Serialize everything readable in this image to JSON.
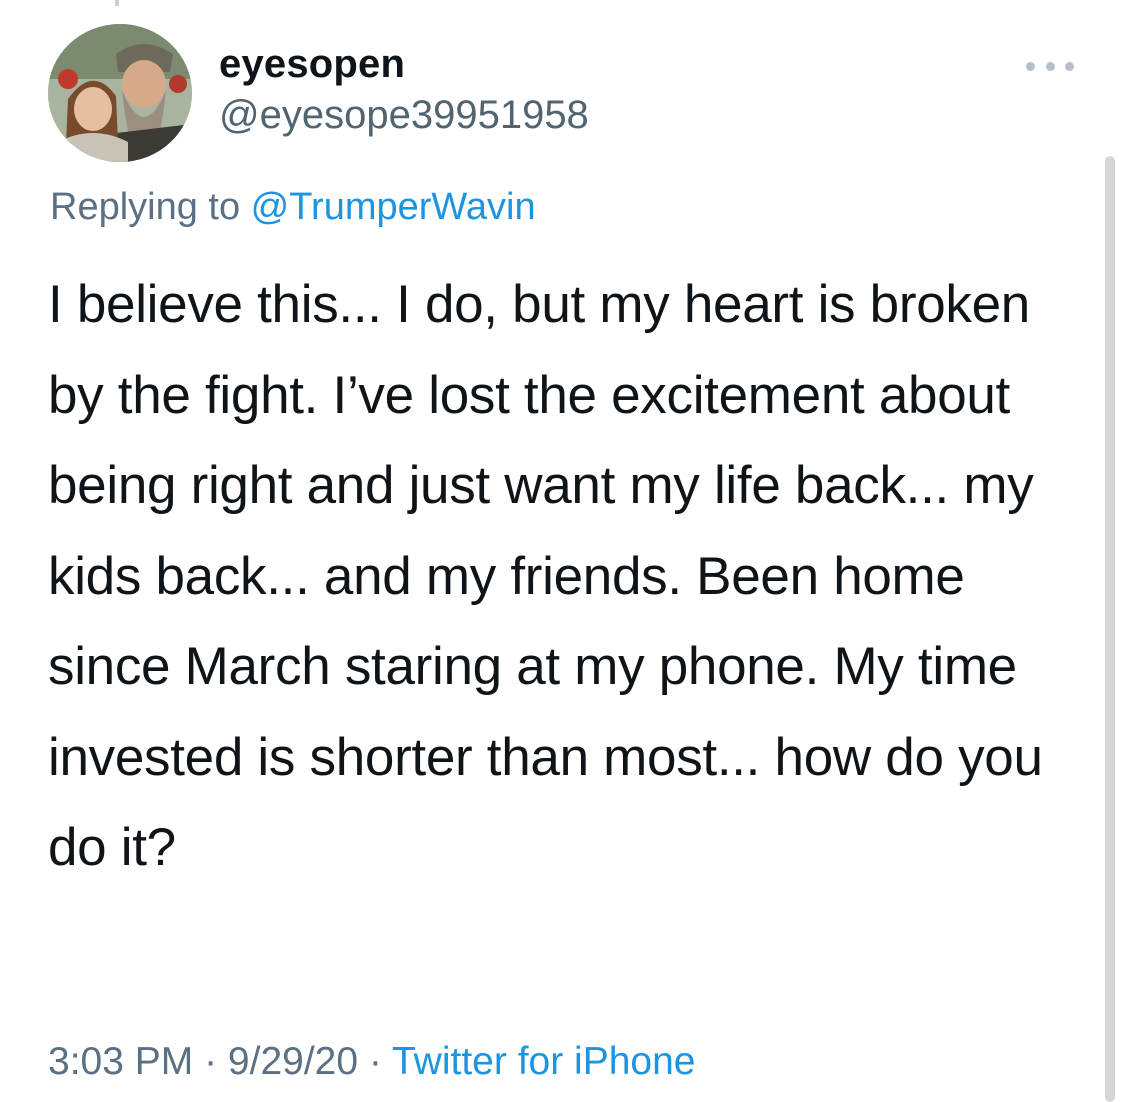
{
  "user": {
    "display_name": "eyesopen",
    "handle": "@eyesope39951958"
  },
  "reply": {
    "prefix": "Replying to ",
    "mention": "@TrumperWavin"
  },
  "tweet": {
    "text": "I believe this... I do, but my heart is broken by the fight. I’ve lost the excitement about being right and just want my life back... my kids back... and my friends. Been home since March staring at my phone. My time invested is shorter than most... how do you do it?"
  },
  "meta": {
    "time": "3:03 PM",
    "separator": " · ",
    "date": "9/29/20",
    "source": "Twitter for iPhone"
  },
  "colors": {
    "text": "#0f1419",
    "secondary": "#5b7083",
    "link": "#1b95e0"
  },
  "icons": {
    "more": "more-horizontal-icon"
  }
}
